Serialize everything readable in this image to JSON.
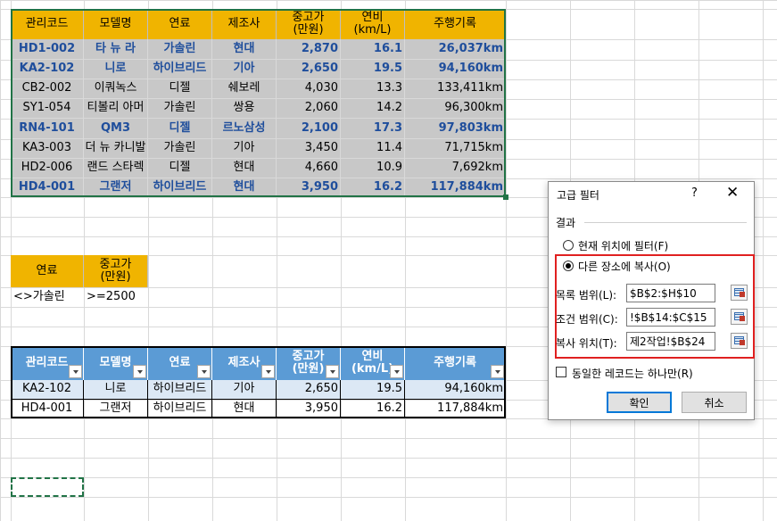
{
  "top_table": {
    "headers": [
      "관리코드",
      "모델명",
      "연료",
      "제조사",
      "중고가\n(만원)",
      "연비\n(km/L)",
      "주행기록"
    ],
    "rows": [
      {
        "style": "blue",
        "cells": [
          "HD1-002",
          "타 뉴 라",
          "가솔린",
          "현대",
          "2,870",
          "16.1",
          "26,037km"
        ]
      },
      {
        "style": "blue",
        "cells": [
          "KA2-102",
          "니로",
          "하이브리드",
          "기아",
          "2,650",
          "19.5",
          "94,160km"
        ]
      },
      {
        "style": "gray",
        "cells": [
          "CB2-002",
          "이쿼녹스",
          "디젤",
          "쉐보레",
          "4,030",
          "13.3",
          "133,411km"
        ]
      },
      {
        "style": "gray",
        "cells": [
          "SY1-054",
          "티볼리 아머",
          "가솔린",
          "쌍용",
          "2,060",
          "14.2",
          "96,300km"
        ]
      },
      {
        "style": "blue",
        "cells": [
          "RN4-101",
          "QM3",
          "디젤",
          "르노삼성",
          "2,100",
          "17.3",
          "97,803km"
        ]
      },
      {
        "style": "gray",
        "cells": [
          "KA3-003",
          "더 뉴 카니발",
          "가솔린",
          "기아",
          "3,450",
          "11.4",
          "71,715km"
        ]
      },
      {
        "style": "gray",
        "cells": [
          "HD2-006",
          "랜드 스타렉",
          "디젤",
          "현대",
          "4,660",
          "10.9",
          "7,692km"
        ]
      },
      {
        "style": "blue",
        "cells": [
          "HD4-001",
          "그랜저",
          "하이브리드",
          "현대",
          "3,950",
          "16.2",
          "117,884km"
        ]
      }
    ]
  },
  "criteria": {
    "headers": [
      "연료",
      "중고가\n(만원)"
    ],
    "values": [
      "<>가솔린",
      ">=2500"
    ]
  },
  "result_table": {
    "headers": [
      "관리코드",
      "모델명",
      "연료",
      "제조사",
      "중고가\n(만원)",
      "연비\n(km/L)",
      "주행기록"
    ],
    "rows": [
      [
        "KA2-102",
        "니로",
        "하이브리드",
        "기아",
        "2,650",
        "19.5",
        "94,160km"
      ],
      [
        "HD4-001",
        "그랜저",
        "하이브리드",
        "현대",
        "3,950",
        "16.2",
        "117,884km"
      ]
    ]
  },
  "dialog": {
    "title": "고급 필터",
    "help": "?",
    "close": "✕",
    "section_label": "결과",
    "radio_filter_in_place": "현재 위치에 필터(F)",
    "radio_copy_to": "다른 장소에 복사(O)",
    "list_range_label": "목록 범위(L):",
    "list_range_value": "$B$2:$H$10",
    "criteria_range_label": "조건 범위(C):",
    "criteria_range_value": "!$B$14:$C$15",
    "copy_to_label": "복사 위치(T):",
    "copy_to_value": "제2작업!$B$24",
    "unique_label": "동일한 레코드는 하나만(R)",
    "ok": "확인",
    "cancel": "취소",
    "selected_option": "copy_to",
    "unique_checked": false
  },
  "colors": {
    "header_fill": "#f0b400",
    "row_gray": "#c8c8c8",
    "blue_text": "#1f4e9c",
    "table_header": "#5b9bd5",
    "band": "#dce8f5",
    "selection": "#217346",
    "highlight": "#e02020"
  }
}
